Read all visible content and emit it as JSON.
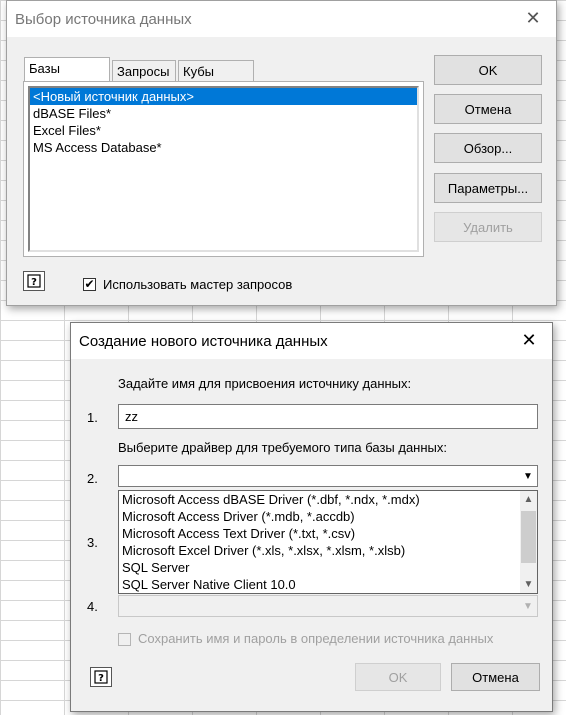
{
  "back_dialog": {
    "title": "Выбор источника данных",
    "tabs": [
      "Базы данных",
      "Запросы",
      "Кубы OLAP"
    ],
    "sources": [
      "<Новый источник данных>",
      "dBASE Files*",
      "Excel Files*",
      "MS Access Database*"
    ],
    "buttons": {
      "ok": "OK",
      "cancel": "Отмена",
      "browse": "Обзор...",
      "options": "Параметры...",
      "delete": "Удалить"
    },
    "use_wizard_label": "Использовать мастер запросов",
    "use_wizard_checked": true,
    "close_glyph": "✕"
  },
  "front_dialog": {
    "title": "Создание нового источника данных",
    "close_glyph": "✕",
    "step1_prompt": "Задайте имя для присвоения источнику данных:",
    "step1_number": "1.",
    "name_value": "zz",
    "step2_prompt": "Выберите драйвер для требуемого типа базы данных:",
    "step2_number": "2.",
    "step3_number": "3.",
    "step4_number": "4.",
    "drivers": [
      "Microsoft Access dBASE Driver (*.dbf, *.ndx, *.mdx)",
      "Microsoft Access Driver (*.mdb, *.accdb)",
      "Microsoft Access Text Driver (*.txt, *.csv)",
      "Microsoft Excel Driver (*.xls, *.xlsx, *.xlsm, *.xlsb)",
      "SQL Server",
      "SQL Server Native Client 10.0"
    ],
    "save_password_label": "Сохранить имя и пароль в определении источника данных",
    "buttons": {
      "ok": "OK",
      "cancel": "Отмена"
    }
  },
  "icons": {
    "help": "help-icon",
    "check": "✔",
    "dropdown_arrow": "▼",
    "scroll_up": "▲",
    "scroll_down": "▼"
  }
}
